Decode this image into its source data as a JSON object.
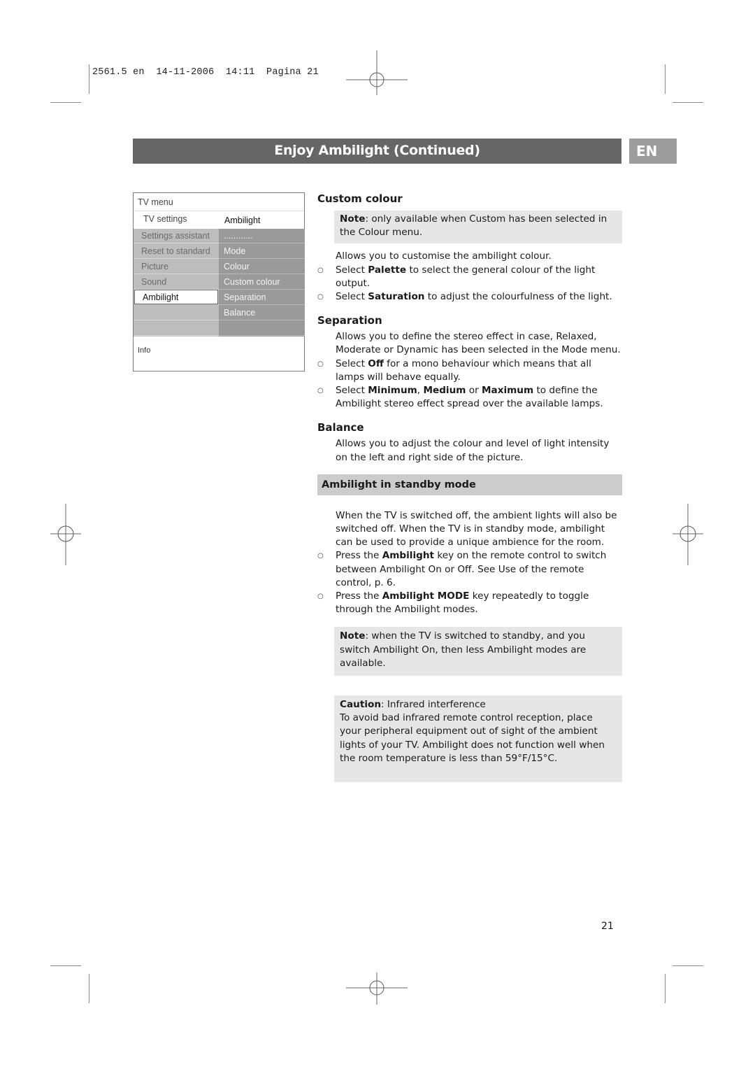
{
  "print_header": "2561.5 en  14-11-2006  14:11  Pagina 21",
  "title": "Enjoy Ambilight  (Continued)",
  "language_badge": "EN",
  "tv_menu": {
    "title": "TV menu",
    "breadcrumb_left": "TV settings",
    "breadcrumb_right": "Ambilight",
    "left_items": [
      {
        "label": "Settings assistant",
        "selected": false
      },
      {
        "label": "Reset to standard",
        "selected": false
      },
      {
        "label": "Picture",
        "selected": false
      },
      {
        "label": "Sound",
        "selected": false
      },
      {
        "label": "Ambilight",
        "selected": true
      },
      {
        "label": "",
        "selected": false
      },
      {
        "label": "",
        "selected": false
      }
    ],
    "right_items": [
      "............",
      "Mode",
      "Colour",
      "Custom colour",
      "Separation",
      "Balance",
      ""
    ],
    "info_label": "Info"
  },
  "sections": {
    "custom_colour": {
      "heading": "Custom colour",
      "note_label": "Note",
      "note_text": ": only available when Custom has been selected in the Colour menu.",
      "intro": "Allows you to customise the ambilight colour.",
      "bullets": [
        {
          "pre": "Select ",
          "bold": "Palette",
          "post": " to select the general colour of the light output."
        },
        {
          "pre": "Select ",
          "bold": "Saturation",
          "post": " to adjust the colourfulness of the light."
        }
      ]
    },
    "separation": {
      "heading": "Separation",
      "intro": "Allows you to define the stereo effect in case, Relaxed, Moderate or Dynamic has been selected in the Mode menu.",
      "bullet1": {
        "pre": "Select ",
        "bold": "Off",
        "post": " for a mono behaviour which means that all lamps will behave equally."
      },
      "bullet2": {
        "pre": "Select ",
        "bold1": "Minimum",
        "sep1": ", ",
        "bold2": "Medium",
        "sep2": " or ",
        "bold3": "Maximum",
        "post": " to define the Ambilight stereo effect spread over the available lamps."
      }
    },
    "balance": {
      "heading": "Balance",
      "intro": "Allows you to adjust the colour and level of light intensity on the left and right side of the picture."
    },
    "standby": {
      "heading": "Ambilight in standby mode",
      "intro": "When the TV is switched off, the ambient lights will also be switched off. When the TV is in standby mode, ambilight can be used to provide a unique ambience for the room.",
      "bullets": [
        {
          "pre": "Press the ",
          "bold": "Ambilight",
          "post": " key on the remote control to switch between Ambilight On or Off. See Use of the remote control, p. 6."
        },
        {
          "pre": "Press the ",
          "bold": "Ambilight MODE",
          "post": " key repeatedly to toggle through the Ambilight modes."
        }
      ],
      "note_label": "Note",
      "note_text": ": when the TV is switched to standby, and you switch Ambilight On, then less Ambilight modes are available.",
      "caution_label": "Caution",
      "caution_title": ": Infrared interference",
      "caution_text": "To avoid bad infrared remote control reception, place your peripheral equipment out of sight of the ambient lights of your TV. Ambilight does not  function well when the room temperature is less than 59°F/15°C."
    }
  },
  "bullet_symbol": "○",
  "page_number": "21"
}
